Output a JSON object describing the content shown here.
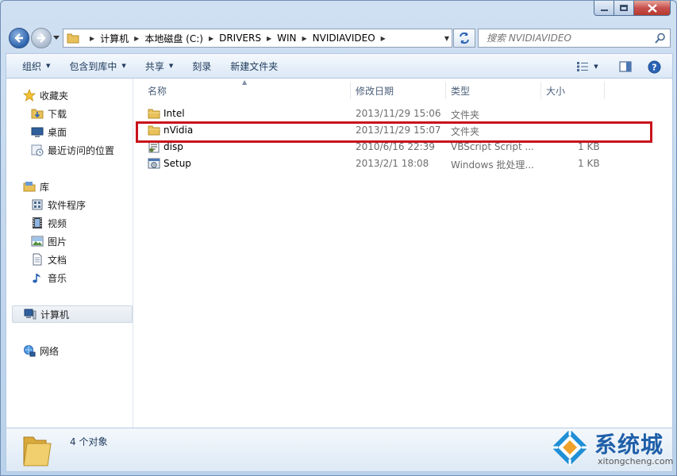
{
  "window": {
    "address_crumbs": [
      "计算机",
      "本地磁盘 (C:)",
      "DRIVERS",
      "WIN",
      "NVIDIAVIDEO"
    ],
    "search_placeholder": "搜索 NVIDIAVIDEO"
  },
  "toolbar": {
    "organize": "组织",
    "include_in_library": "包含到库中",
    "share": "共享",
    "burn": "刻录",
    "new_folder": "新建文件夹"
  },
  "navigation": {
    "favorites": "收藏夹",
    "downloads": "下载",
    "desktop": "桌面",
    "recent": "最近访问的位置",
    "libraries": "库",
    "software": "软件程序",
    "videos": "视频",
    "pictures": "图片",
    "documents": "文档",
    "music": "音乐",
    "computer": "计算机",
    "network": "网络"
  },
  "columns": {
    "name": "名称",
    "modified": "修改日期",
    "type": "类型",
    "size": "大小"
  },
  "files": [
    {
      "name": "Intel",
      "modified": "2013/11/29 15:06",
      "type": "文件夹",
      "size": "",
      "icon": "folder-icon"
    },
    {
      "name": "nVidia",
      "modified": "2013/11/29 15:07",
      "type": "文件夹",
      "size": "",
      "icon": "folder-icon"
    },
    {
      "name": "disp",
      "modified": "2010/6/16 22:39",
      "type": "VBScript Script ...",
      "size": "1 KB",
      "icon": "vbscript-file-icon"
    },
    {
      "name": "Setup",
      "modified": "2013/2/1 18:08",
      "type": "Windows 批处理...",
      "size": "1 KB",
      "icon": "batch-file-icon"
    }
  ],
  "details": {
    "count": "4 个对象"
  },
  "watermark": {
    "brand": "系统城",
    "url": "xitongcheng.com"
  },
  "colors": {
    "highlight_border": "#c9131c",
    "folder": "#e8c15a",
    "accent_blue": "#1f5fa8"
  }
}
